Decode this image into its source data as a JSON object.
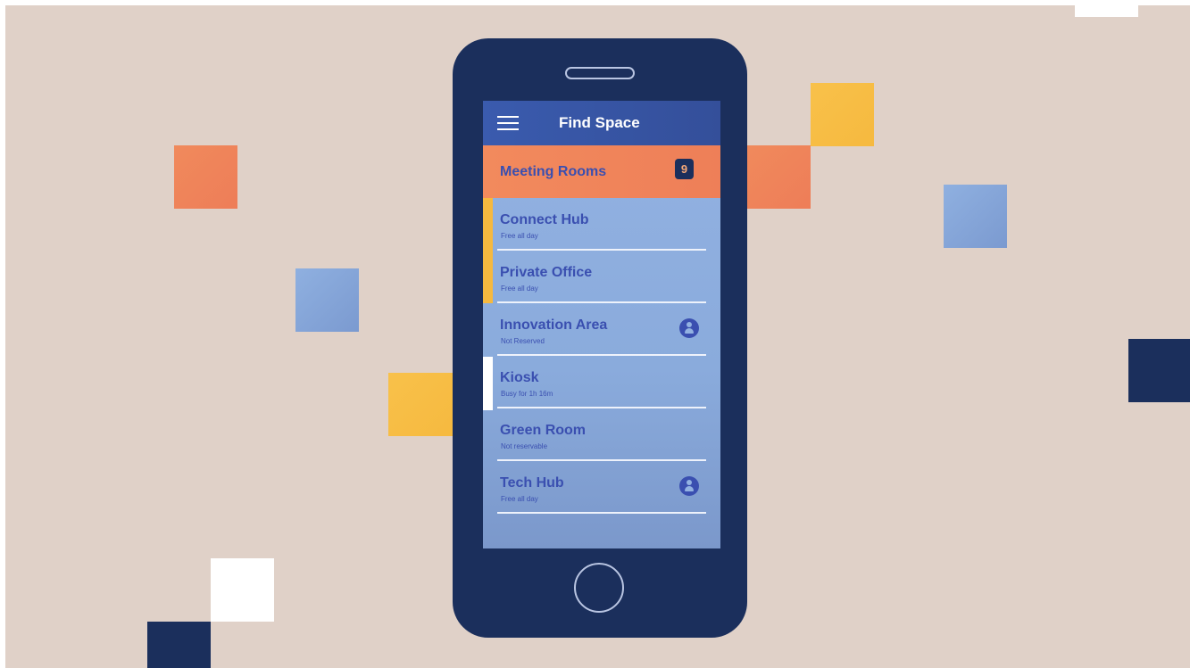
{
  "app": {
    "title": "Find Space",
    "menu_icon": "hamburger-menu-icon"
  },
  "category": {
    "label": "Meeting Rooms",
    "count": "9",
    "color": "#ef8159"
  },
  "rooms": [
    {
      "name": "Connect Hub",
      "status": "Free all day",
      "indicator": "yellow",
      "icon": ""
    },
    {
      "name": "Private Office",
      "status": "Free all day",
      "indicator": "yellow",
      "icon": ""
    },
    {
      "name": "Innovation Area",
      "status": "Not Reserved",
      "indicator": "",
      "icon": "user-icon"
    },
    {
      "name": "Kiosk",
      "status": "Busy for 1h 16m",
      "indicator": "white",
      "icon": ""
    },
    {
      "name": "Green Room",
      "status": "Not reservable",
      "indicator": "",
      "icon": ""
    },
    {
      "name": "Tech Hub",
      "status": "Free all day",
      "indicator": "",
      "icon": "user-icon"
    }
  ],
  "colors": {
    "background": "#e0d1c8",
    "phone": "#1b2f5c",
    "appbar": "#3a5bae",
    "list": "#8fb0e0",
    "accent_text": "#3a4fb0",
    "indicator_yellow": "#f6b93f",
    "indicator_white": "#ffffff"
  }
}
